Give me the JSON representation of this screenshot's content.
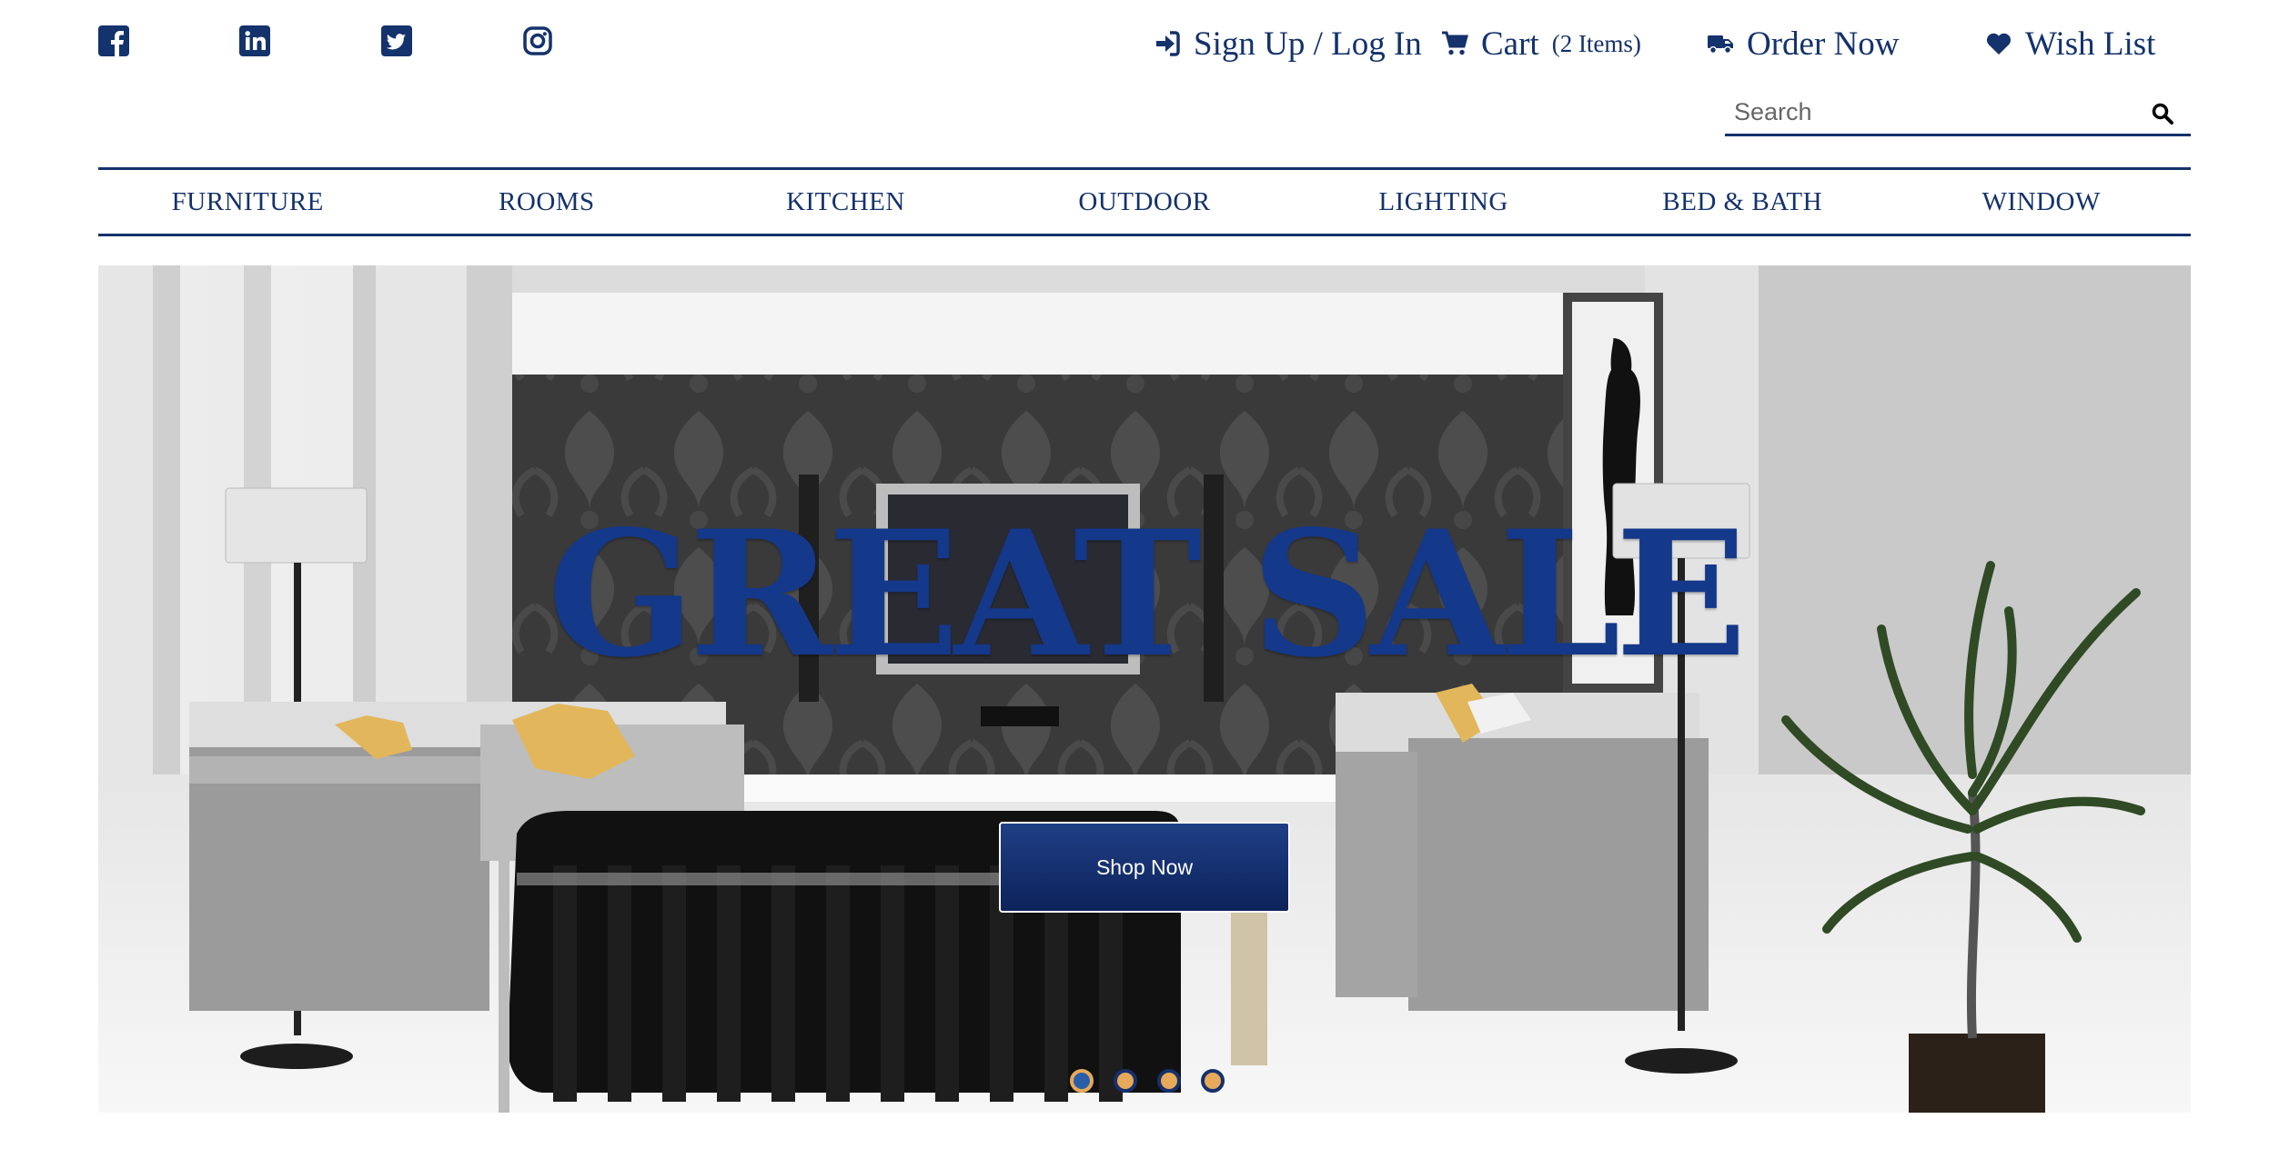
{
  "social": [
    {
      "name": "facebook",
      "icon": "facebook-icon"
    },
    {
      "name": "linkedin",
      "icon": "linkedin-icon"
    },
    {
      "name": "twitter",
      "icon": "twitter-icon"
    },
    {
      "name": "instagram",
      "icon": "instagram-icon"
    }
  ],
  "top_links": {
    "signin": {
      "label": "Sign Up / Log In",
      "icon": "sign-in-icon"
    },
    "cart": {
      "label": "Cart",
      "count_text": "(2 Items)",
      "icon": "cart-icon"
    },
    "order": {
      "label": "Order Now",
      "icon": "truck-icon"
    },
    "wishlist": {
      "label": "Wish List",
      "icon": "heart-icon"
    }
  },
  "search": {
    "placeholder": "Search",
    "value": ""
  },
  "nav": [
    "FURNITURE",
    "ROOMS",
    "KITCHEN",
    "OUTDOOR",
    "LIGHTING",
    "BED & BATH",
    "WINDOW"
  ],
  "hero": {
    "headline": "GREAT SALE",
    "cta": "Shop Now",
    "slides": 4,
    "active_slide": 1
  },
  "colors": {
    "brand": "#14326b",
    "headline": "#14388a",
    "dot": "#e6aa5a"
  }
}
